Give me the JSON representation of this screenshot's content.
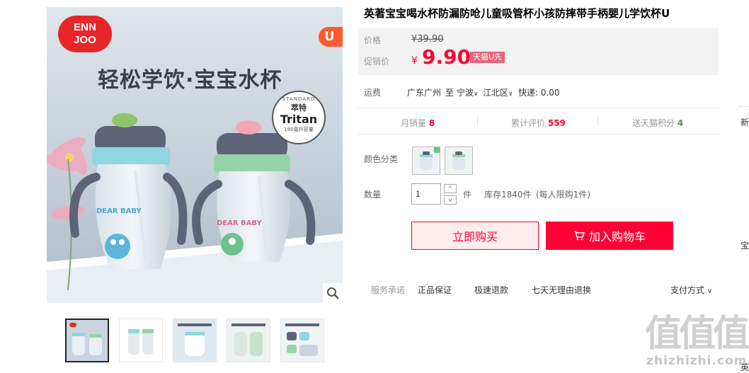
{
  "product": {
    "title": "英著宝宝喝水杯防漏防呛儿童吸管杯小孩防摔带手柄婴儿学饮杯U"
  },
  "gallery": {
    "brand_top": "ENN",
    "brand_bottom": "JOO",
    "u_badge": "U",
    "headline": "轻松学饮·宝宝水杯",
    "seal_top": "STANDARD",
    "seal_brand": "萃特",
    "seal_main": "Tritan",
    "seal_bottom": "180毫升容量",
    "cup_label_left": "DEAR BABY",
    "cup_label_right": "DEAR BABY"
  },
  "price": {
    "original_label": "价格",
    "original_value": "¥39.90",
    "promo_label": "促销价",
    "currency": "¥",
    "promo_value": "9.90",
    "badge": "天猫U先"
  },
  "shipping": {
    "label": "运费",
    "from": "广东广州",
    "to_word": "至",
    "city": "宁波",
    "district": "江北区",
    "express": "快递: 0.00"
  },
  "stats": {
    "monthly_sales_label": "月销量",
    "monthly_sales_value": "8",
    "reviews_label": "累计评价",
    "reviews_value": "559",
    "points_label": "送天猫积分",
    "points_value": "4"
  },
  "sku": {
    "color_label": "颜色分类"
  },
  "quantity": {
    "label": "数量",
    "value": "1",
    "unit": "件",
    "stock": "库存1840件",
    "limit": "(每人限购1件)",
    "up": "^",
    "down": "v"
  },
  "actions": {
    "buy_now": "立即购买",
    "add_to_cart": "加入购物车"
  },
  "service": {
    "label": "服务承诺",
    "items": [
      "正品保证",
      "极速退款",
      "七天无理由退换"
    ],
    "payment": "支付方式"
  },
  "edge": {
    "chars": [
      "新",
      "宝",
      "英"
    ]
  },
  "watermark": {
    "glyphs": "值值值",
    "url": "zhizhizhi.com"
  },
  "colors": {
    "accent": "#ff0036",
    "badge": "#e8637b",
    "stat_red": "#ff0036",
    "stat_green": "#4b9b38"
  }
}
